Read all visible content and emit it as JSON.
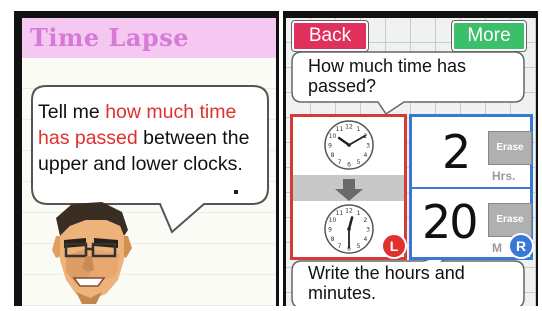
{
  "left_screen": {
    "title": "Time Lapse",
    "speech": {
      "part1": "Tell me ",
      "highlight": "how much time has passed",
      "part2": " between the upper and lower clocks."
    }
  },
  "right_screen": {
    "back_label": "Back",
    "more_label": "More",
    "question": "How much time has passed?",
    "instruction": "Write the hours and minutes.",
    "answer": {
      "hours_value": "2",
      "hours_unit": "Hrs.",
      "minutes_value": "20",
      "minutes_unit": "M",
      "erase_label": "Erase"
    },
    "clock_badge": "L",
    "answer_badge": "R",
    "clocks": {
      "upper": {
        "hour": 10,
        "minute": 10
      },
      "lower": {
        "hour": 12,
        "minute": 30
      }
    }
  },
  "colors": {
    "title_pink": "#d77ad6",
    "highlight_red": "#e03030",
    "back_button": "#e0315c",
    "more_button": "#3cbf6b",
    "clock_border": "#d83a3a",
    "answer_border": "#3a78d8"
  }
}
